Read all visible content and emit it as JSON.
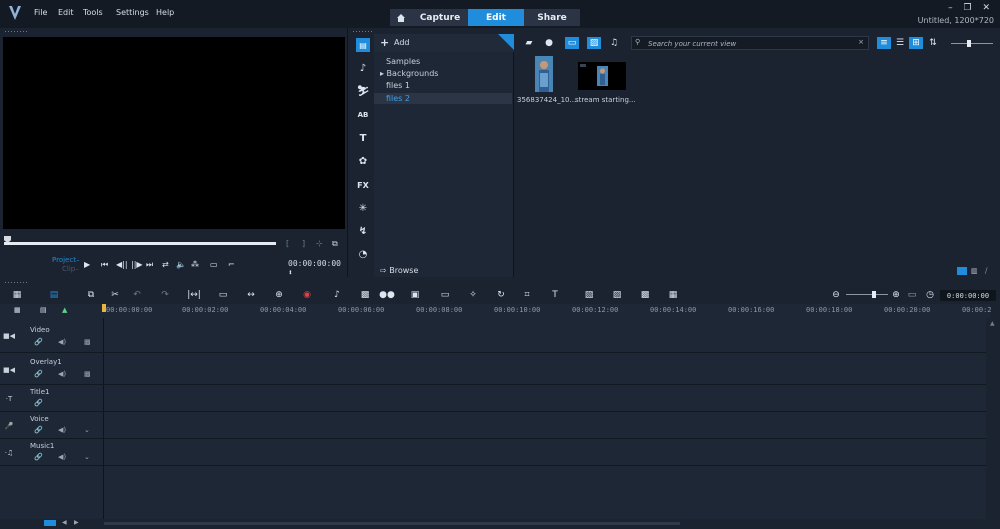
{
  "app": {
    "menu": [
      "File",
      "Edit",
      "Tools",
      "Settings",
      "Help"
    ],
    "tabs": [
      "Capture",
      "Edit",
      "Share"
    ],
    "window_controls": "– ❐ ✕",
    "project_info": "Untitled, 1200*720"
  },
  "player": {
    "project_label": "Project–",
    "clip_label": "Clip–",
    "timecode": "00:00:00:00 ⬍"
  },
  "library": {
    "tools": [
      "media",
      "instant-project",
      "transition",
      "title",
      "text",
      "graphics",
      "FX",
      "path",
      "motion",
      "track"
    ],
    "add_label": "Add",
    "tree": [
      {
        "label": "Samples"
      },
      {
        "label": "▸ Backgrounds"
      },
      {
        "label": "files 1"
      },
      {
        "label": "files 2"
      }
    ],
    "selected_folder": "files 2",
    "browse_label": "Browse",
    "search_placeholder": "Search your current view",
    "thumbnails": [
      {
        "caption": "356837424_10..."
      },
      {
        "caption": "stream starting..."
      }
    ]
  },
  "timeline": {
    "timecode": "0:00:00:00",
    "ruler": [
      "00:00:00:00",
      "00:00:02:00",
      "00:00:04:00",
      "00:00:06:00",
      "00:00:08:00",
      "00:00:10:00",
      "00:00:12:00",
      "00:00:14:00",
      "00:00:16:00",
      "00:00:18:00",
      "00:00:20:00",
      "00:00:2"
    ],
    "tracks": [
      {
        "name": "Video"
      },
      {
        "name": "Overlay1"
      },
      {
        "name": "Title1"
      },
      {
        "name": "Voice"
      },
      {
        "name": "Music1"
      }
    ]
  },
  "colors": {
    "accent": "#1f8ddb",
    "background": "#1b2330",
    "titlebar": "#131a24"
  }
}
